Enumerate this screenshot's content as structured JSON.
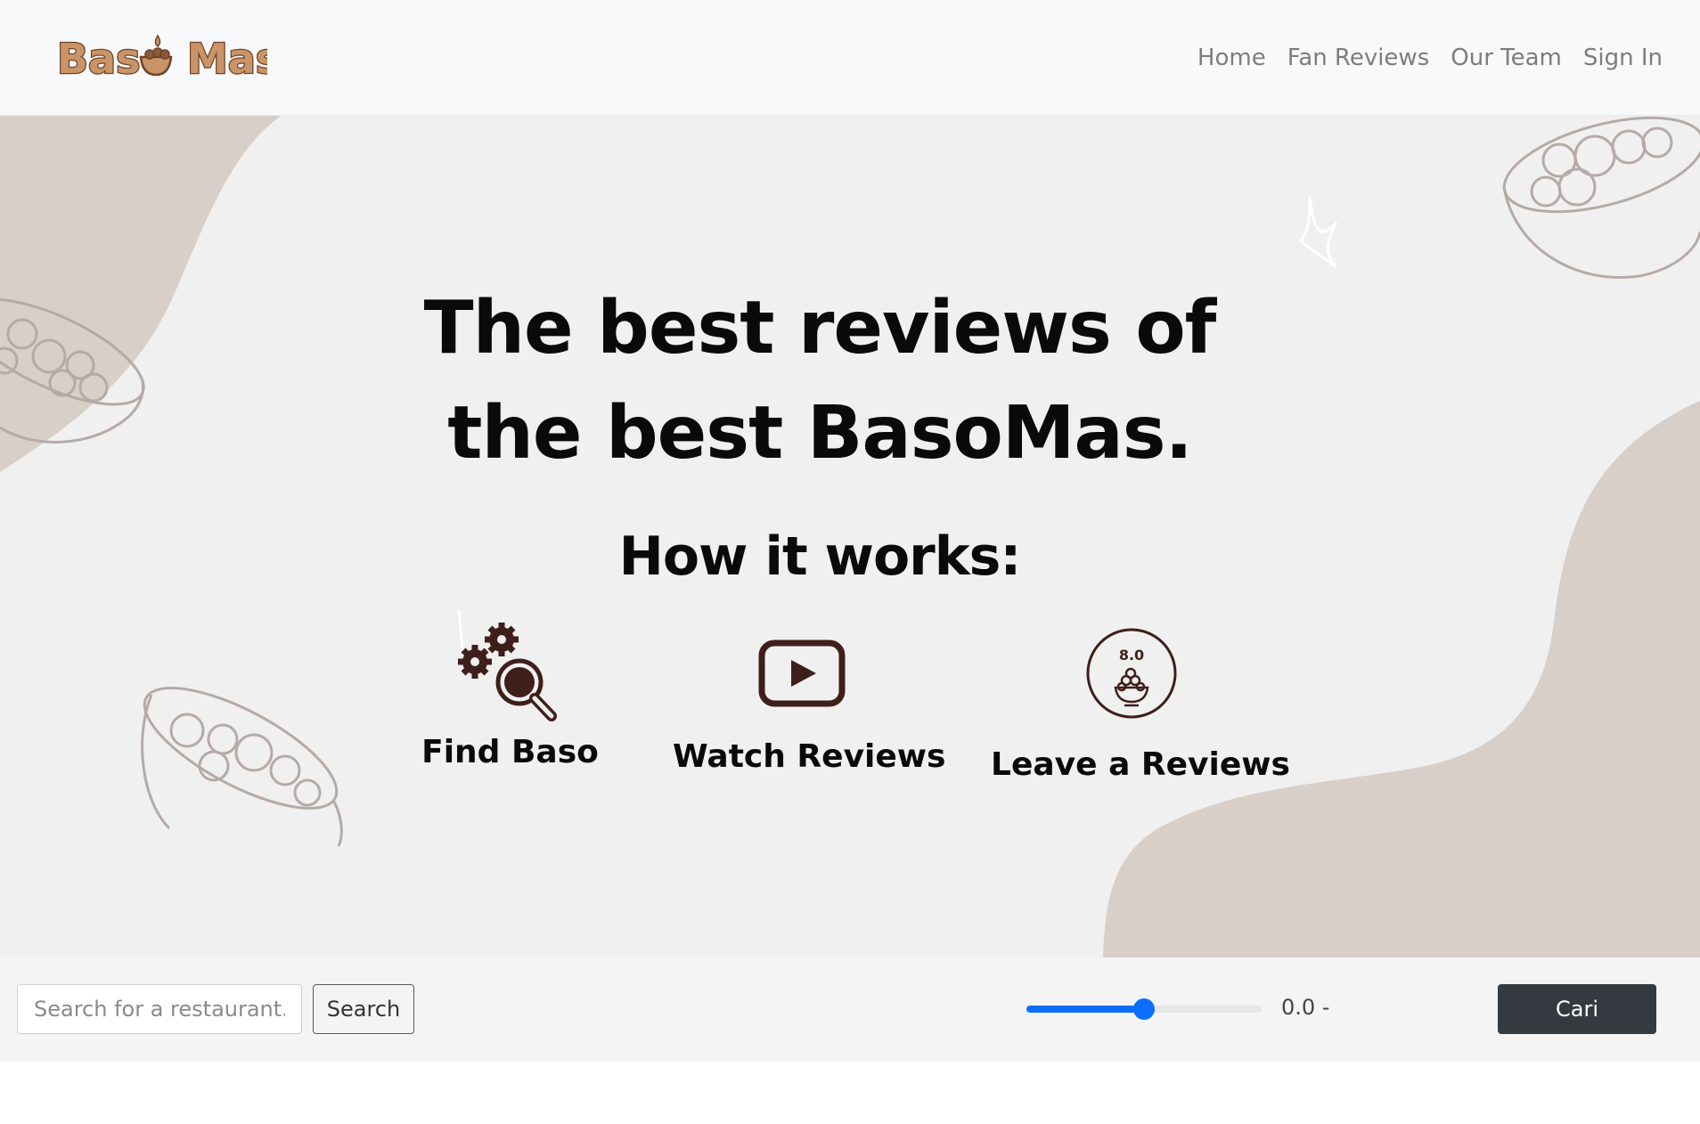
{
  "brand": {
    "logo_text": "Basō Mas"
  },
  "nav": {
    "items": [
      {
        "label": "Home"
      },
      {
        "label": "Fan Reviews"
      },
      {
        "label": "Our Team"
      },
      {
        "label": "Sign In"
      }
    ]
  },
  "hero": {
    "title_line1": "The best reviews of",
    "title_line2": "the best BasoMas.",
    "how_title": "How it works:",
    "steps": [
      {
        "label": "Find Baso",
        "icon": "gears-magnifier-icon"
      },
      {
        "label": "Watch Reviews",
        "icon": "play-video-icon"
      },
      {
        "label": "Leave a Reviews",
        "icon": "rating-bowl-icon",
        "badge": "8.0"
      }
    ]
  },
  "search": {
    "placeholder": "Search for a restaurant...",
    "button_label": "Search",
    "slider_fraction": 0.5,
    "range_text": "0.0 -",
    "submit_label": "Cari"
  },
  "colors": {
    "brand_brown": "#b07a4e",
    "icon_brown": "#3f1f1a",
    "blob": "#d8cfc8",
    "slider_blue": "#0d6efd",
    "dark_button": "#343a40"
  }
}
